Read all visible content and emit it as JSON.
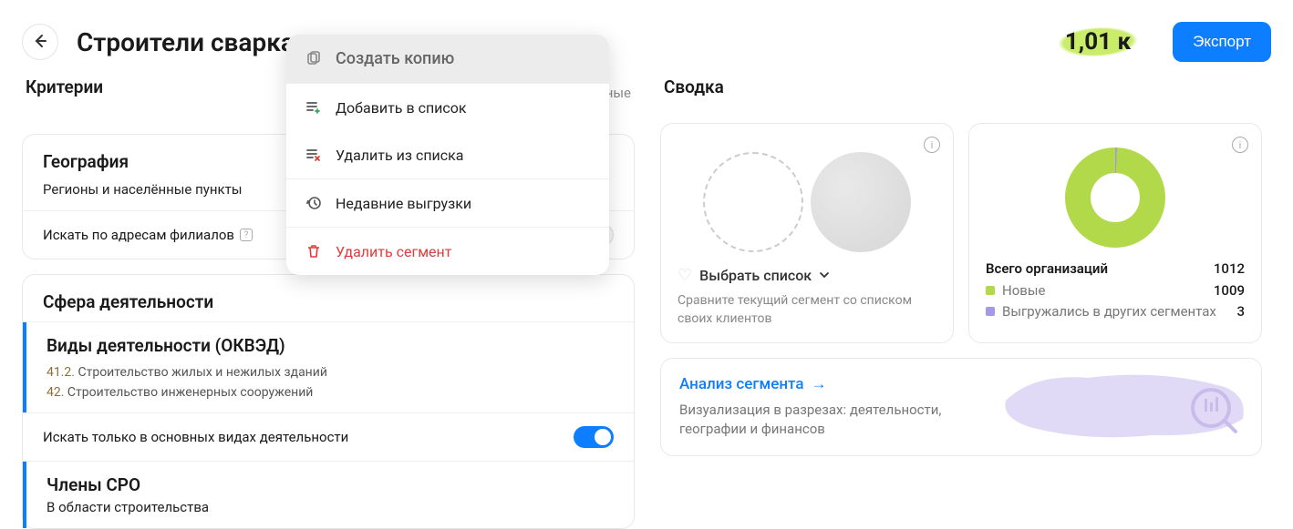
{
  "header": {
    "title": "Строители сварка",
    "count": "1,01 к",
    "export": "Экспорт"
  },
  "menu": {
    "copy": "Создать копию",
    "add_to_list": "Добавить в список",
    "remove_from_list": "Удалить из списка",
    "recent_exports": "Недавние выгрузки",
    "delete_segment": "Удалить сегмент"
  },
  "criteria": {
    "heading": "Критерии",
    "modified": "менённые",
    "geography": {
      "title": "География",
      "subtitle": "Регионы и населённые пункты",
      "branch_search": "Искать по адресам филиалов"
    },
    "activity": {
      "title": "Сфера деятельности",
      "okved_title": "Виды деятельности (ОКВЭД)",
      "okved1_code": "41.2.",
      "okved1_text": "Строительство жилых и нежилых зданий",
      "okved2_code": "42.",
      "okved2_text": "Строительство инженерных сооружений",
      "main_only": "Искать только в основных видах деятельности",
      "sro_title": "Члены СРО",
      "sro_text": "В области строительства"
    }
  },
  "summary": {
    "heading": "Сводка",
    "select_list": "Выбрать список",
    "compare_text": "Сравните текущий сегмент со списком своих клиентов",
    "total_label": "Всего организаций",
    "total_val": "1012",
    "new_label": "Новые",
    "new_val": "1009",
    "exported_label": "Выгружались в других сегментах",
    "exported_val": "3",
    "analysis_link": "Анализ сегмента",
    "analysis_desc": "Визуализация в разрезах: деятельности, географии и финансов"
  },
  "chart_data": {
    "type": "pie",
    "title": "Всего организаций",
    "series": [
      {
        "name": "Новые",
        "value": 1009,
        "color": "#b2d94a"
      },
      {
        "name": "Выгружались в других сегментах",
        "value": 3,
        "color": "#a598e6"
      }
    ],
    "total": 1012
  }
}
